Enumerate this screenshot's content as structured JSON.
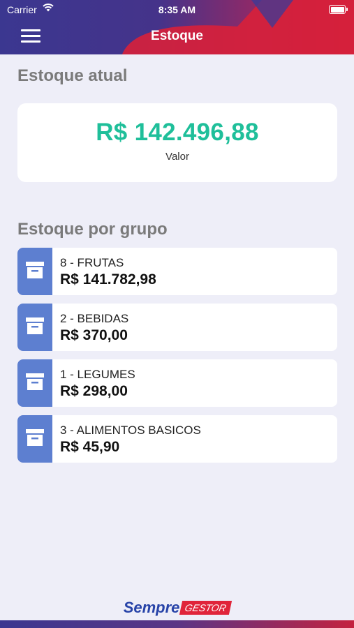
{
  "status_bar": {
    "carrier": "Carrier",
    "time": "8:35 AM"
  },
  "nav": {
    "title": "Estoque",
    "menu_icon": "hamburger-menu-icon"
  },
  "current_stock": {
    "heading": "Estoque atual",
    "value": "R$ 142.496,88",
    "label": "Valor"
  },
  "groups": {
    "heading": "Estoque por grupo",
    "items": [
      {
        "name": "8 - FRUTAS",
        "value": "R$ 141.782,98",
        "icon": "archive-box-icon"
      },
      {
        "name": "2 - BEBIDAS",
        "value": "R$ 370,00",
        "icon": "archive-box-icon"
      },
      {
        "name": "1 - LEGUMES",
        "value": "R$ 298,00",
        "icon": "archive-box-icon"
      },
      {
        "name": "3 - ALIMENTOS BASICOS",
        "value": "R$ 45,90",
        "icon": "archive-box-icon"
      }
    ]
  },
  "footer": {
    "logo_part1": "Sempre",
    "logo_part2": "GESTOR"
  },
  "colors": {
    "accent_teal": "#1fbf9a",
    "header_blue": "#3e3a8c",
    "header_red": "#d8203a",
    "group_icon_bg": "#5d7fd0"
  }
}
